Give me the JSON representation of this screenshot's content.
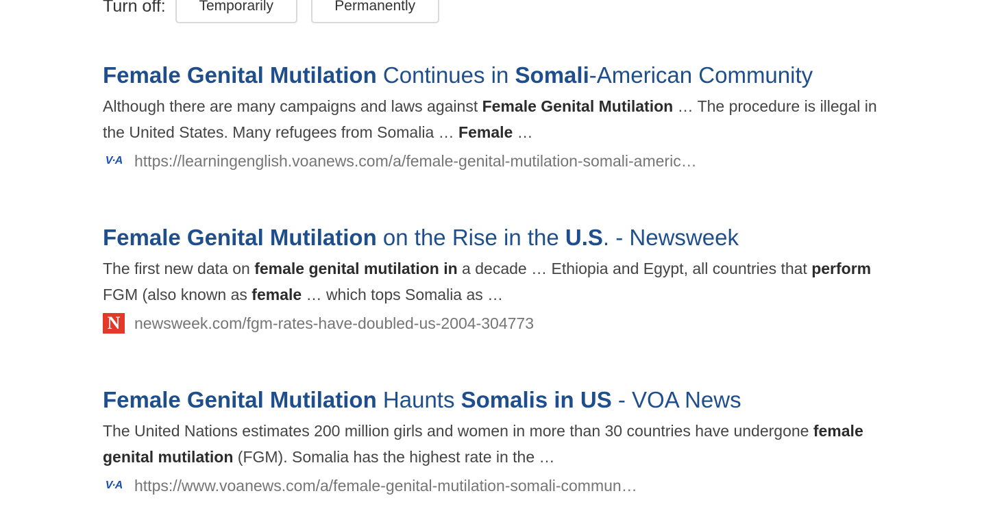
{
  "turn_off": {
    "label": "Turn off:",
    "temporarily": "Temporarily",
    "permanently": "Permanently"
  },
  "results": [
    {
      "title": [
        {
          "text": "Female Genital Mutilation",
          "bold": true
        },
        {
          "text": " Continues in ",
          "bold": false
        },
        {
          "text": "Somali",
          "bold": true
        },
        {
          "text": "-American Community",
          "bold": false
        }
      ],
      "snippet": [
        {
          "text": "Although there are many campaigns and laws against ",
          "bold": false
        },
        {
          "text": "Female Genital Mutilation",
          "bold": true
        },
        {
          "text": " … The procedure is illegal in the United States. Many refugees from Somalia … ",
          "bold": false
        },
        {
          "text": "Female",
          "bold": true
        },
        {
          "text": " …",
          "bold": false
        }
      ],
      "favicon": "voa-icon",
      "favicon_text": "V·A",
      "url": "https://learningenglish.voanews.com/a/female-genital-mutilation-somali-americ…"
    },
    {
      "title": [
        {
          "text": "Female Genital Mutilation",
          "bold": true
        },
        {
          "text": " on the Rise in the ",
          "bold": false
        },
        {
          "text": "U.S",
          "bold": true
        },
        {
          "text": ". - Newsweek",
          "bold": false
        }
      ],
      "snippet": [
        {
          "text": "The first new data on ",
          "bold": false
        },
        {
          "text": "female genital mutilation in",
          "bold": true
        },
        {
          "text": " a decade … Ethiopia and Egypt, all countries that ",
          "bold": false
        },
        {
          "text": "perform",
          "bold": true
        },
        {
          "text": " FGM (also known as ",
          "bold": false
        },
        {
          "text": "female",
          "bold": true
        },
        {
          "text": " … which tops Somalia as …",
          "bold": false
        }
      ],
      "favicon": "newsweek-icon",
      "favicon_text": "N",
      "url": "newsweek.com/fgm-rates-have-doubled-us-2004-304773"
    },
    {
      "title": [
        {
          "text": "Female Genital Mutilation",
          "bold": true
        },
        {
          "text": " Haunts ",
          "bold": false
        },
        {
          "text": "Somalis in US",
          "bold": true
        },
        {
          "text": " - VOA News",
          "bold": false
        }
      ],
      "snippet": [
        {
          "text": "The United Nations estimates 200 million girls and women in more than 30 countries have undergone ",
          "bold": false
        },
        {
          "text": "female genital mutilation",
          "bold": true
        },
        {
          "text": " (FGM). Somalia has the highest rate in the …",
          "bold": false
        }
      ],
      "favicon": "voa-icon",
      "favicon_text": "V·A",
      "url": "https://www.voanews.com/a/female-genital-mutilation-somali-commun…"
    }
  ]
}
